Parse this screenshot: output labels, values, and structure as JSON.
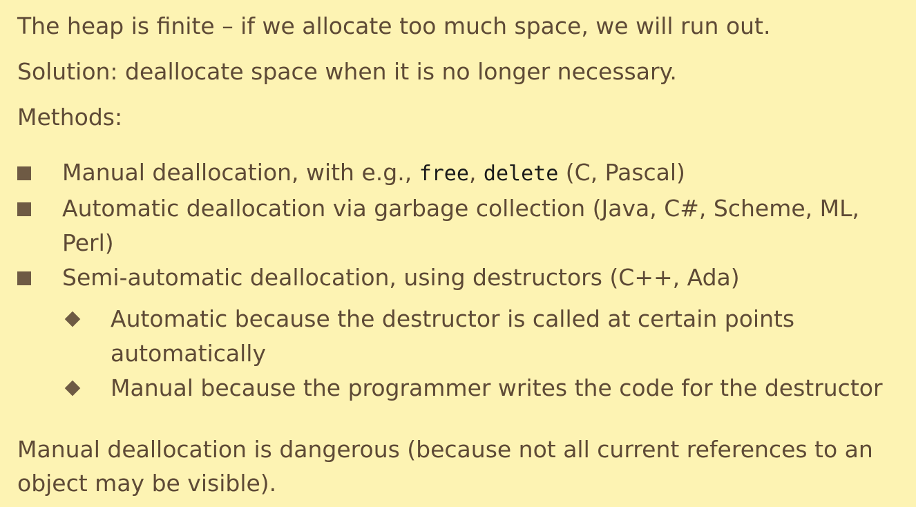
{
  "intro": {
    "line1": "The heap is finite – if we allocate too much space, we will run out.",
    "line2": "Solution: deallocate space when it is no longer necessary.",
    "line3": "Methods:"
  },
  "bullets": {
    "b1": {
      "prefix": "Manual deallocation, with e.g., ",
      "code1": "free",
      "sep": ", ",
      "code2": "delete",
      "suffix": " (C, Pascal)"
    },
    "b2": {
      "text": "Automatic deallocation via garbage collection (Java, C#, Scheme, ML, Perl)"
    },
    "b3": {
      "text": "Semi-automatic deallocation, using destructors (C++, Ada)",
      "sub": [
        {
          "text": "Automatic because the destructor is called at certain points automatically"
        },
        {
          "text": "Manual because the programmer writes the code for the destructor"
        }
      ]
    }
  },
  "closing": {
    "text": "Manual deallocation is dangerous (because not all current references to an object may be visible)."
  },
  "colors": {
    "background": "#fdf3b3",
    "text": "#5e4a36",
    "marker": "#6e5a44",
    "code": "#1a1a1a"
  },
  "icons": {
    "bullet": "square-bullet-icon",
    "sub_bullet": "diamond-bullet-icon"
  }
}
